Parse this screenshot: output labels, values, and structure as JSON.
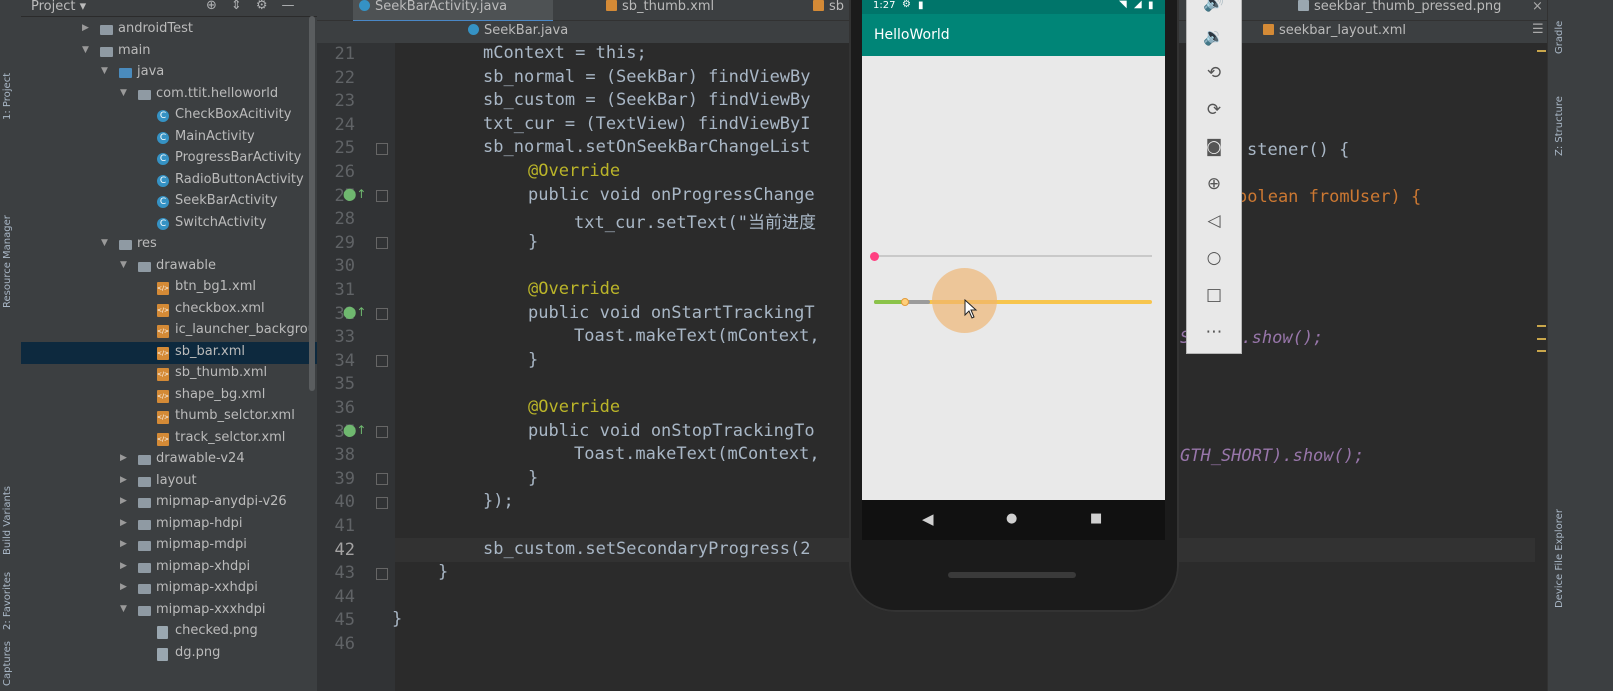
{
  "project_panel": {
    "title": "Project",
    "tree": [
      {
        "label": "androidTest",
        "kind": "folder",
        "depth": 3,
        "expanded": false
      },
      {
        "label": "main",
        "kind": "folder",
        "depth": 3,
        "expanded": true
      },
      {
        "label": "java",
        "kind": "folder-blue",
        "depth": 4,
        "expanded": true
      },
      {
        "label": "com.ttit.helloworld",
        "kind": "folder",
        "depth": 5,
        "expanded": true
      },
      {
        "label": "CheckBoxAcitivity",
        "kind": "class",
        "depth": 6
      },
      {
        "label": "MainActivity",
        "kind": "class",
        "depth": 6
      },
      {
        "label": "ProgressBarActivity",
        "kind": "class",
        "depth": 6
      },
      {
        "label": "RadioButtonActivity",
        "kind": "class",
        "depth": 6
      },
      {
        "label": "SeekBarActivity",
        "kind": "class",
        "depth": 6
      },
      {
        "label": "SwitchActivity",
        "kind": "class",
        "depth": 6
      },
      {
        "label": "res",
        "kind": "folder",
        "depth": 4,
        "expanded": true
      },
      {
        "label": "drawable",
        "kind": "folder",
        "depth": 5,
        "expanded": true
      },
      {
        "label": "btn_bg1.xml",
        "kind": "xml",
        "depth": 6
      },
      {
        "label": "checkbox.xml",
        "kind": "xml",
        "depth": 6
      },
      {
        "label": "ic_launcher_backgrou",
        "kind": "xml",
        "depth": 6
      },
      {
        "label": "sb_bar.xml",
        "kind": "xml",
        "depth": 6,
        "selected": true
      },
      {
        "label": "sb_thumb.xml",
        "kind": "xml",
        "depth": 6
      },
      {
        "label": "shape_bg.xml",
        "kind": "xml",
        "depth": 6
      },
      {
        "label": "thumb_selctor.xml",
        "kind": "xml",
        "depth": 6
      },
      {
        "label": "track_selctor.xml",
        "kind": "xml",
        "depth": 6
      },
      {
        "label": "drawable-v24",
        "kind": "folder",
        "depth": 5,
        "expanded": false
      },
      {
        "label": "layout",
        "kind": "folder",
        "depth": 5,
        "expanded": false
      },
      {
        "label": "mipmap-anydpi-v26",
        "kind": "folder",
        "depth": 5,
        "expanded": false
      },
      {
        "label": "mipmap-hdpi",
        "kind": "folder",
        "depth": 5,
        "expanded": false
      },
      {
        "label": "mipmap-mdpi",
        "kind": "folder",
        "depth": 5,
        "expanded": false
      },
      {
        "label": "mipmap-xhdpi",
        "kind": "folder",
        "depth": 5,
        "expanded": false
      },
      {
        "label": "mipmap-xxhdpi",
        "kind": "folder",
        "depth": 5,
        "expanded": false
      },
      {
        "label": "mipmap-xxxhdpi",
        "kind": "folder",
        "depth": 5,
        "expanded": true
      },
      {
        "label": "checked.png",
        "kind": "png",
        "depth": 6
      },
      {
        "label": "dg.png",
        "kind": "png",
        "depth": 6
      }
    ]
  },
  "left_stripe": {
    "project_tab": "1: Project",
    "resource_manager": "Resource Manager",
    "build_variants": "Build Variants",
    "favorites": "2: Favorites",
    "captures": "Captures"
  },
  "right_stripe": {
    "gradle": "Gradle",
    "structure": "Z: Structure",
    "device_explorer": "Device File Explorer"
  },
  "tabs_row1": [
    {
      "label": "SeekBarActivity.java",
      "icon": "class",
      "active": true
    },
    {
      "label": "sb_thumb.xml",
      "icon": "xml"
    },
    {
      "label": "sb",
      "icon": "xml"
    },
    {
      "label": "seekbar_thumb_pressed.png",
      "icon": "png"
    }
  ],
  "tabs_row2": [
    {
      "label": "SeekBar.java",
      "icon": "class"
    },
    {
      "label": "seekbar_layout.xml",
      "icon": "xml"
    }
  ],
  "editor": {
    "line_numbers": [
      "21",
      "22",
      "23",
      "24",
      "25",
      "26",
      "27",
      "28",
      "29",
      "30",
      "31",
      "32",
      "33",
      "34",
      "35",
      "36",
      "37",
      "38",
      "39",
      "40",
      "41",
      "42",
      "43",
      "44",
      "45",
      "46"
    ],
    "current_line": "42",
    "left_lines": [
      "mContext = this;",
      "sb_normal = (SeekBar) findViewBy",
      "sb_custom = (SeekBar) findViewBy",
      "txt_cur = (TextView) findViewByI",
      "sb_normal.setOnSeekBarChangeList",
      "@Override",
      "public void onProgressChange",
      "txt_cur.setText(\"当前进度",
      "}",
      "",
      "@Override",
      "public void onStartTrackingT",
      "Toast.makeText(mContext,",
      "}",
      "",
      "@Override",
      "public void onStopTrackingTo",
      "Toast.makeText(mContext,",
      "}",
      "});",
      "",
      "sb_custom.setSecondaryProgress(2",
      "}",
      "",
      "}",
      ""
    ],
    "right_fragments": {
      "line25": "stener() {",
      "line27": "oolean fromUser) {",
      "line33": "SHORT).show();",
      "line38": "GTH_SHORT).show();"
    }
  },
  "emulator": {
    "status_time": "1:27",
    "app_title": "HelloWorld",
    "seekbar_normal_progress": 0.0,
    "seekbar_custom_progress": 0.11,
    "seekbar_custom_secondary": 0.2,
    "colors": {
      "primary": "#008577",
      "primary_dark": "#00756a",
      "accent": "#ff4081",
      "progress": "#8bc34a",
      "track": "#f7c54e"
    }
  },
  "emulator_toolbar": [
    "volume-up-icon",
    "volume-down-icon",
    "rotate-left-icon",
    "rotate-right-icon",
    "camera-icon",
    "zoom-icon",
    "back-icon",
    "home-icon",
    "overview-icon",
    "more-icon"
  ]
}
